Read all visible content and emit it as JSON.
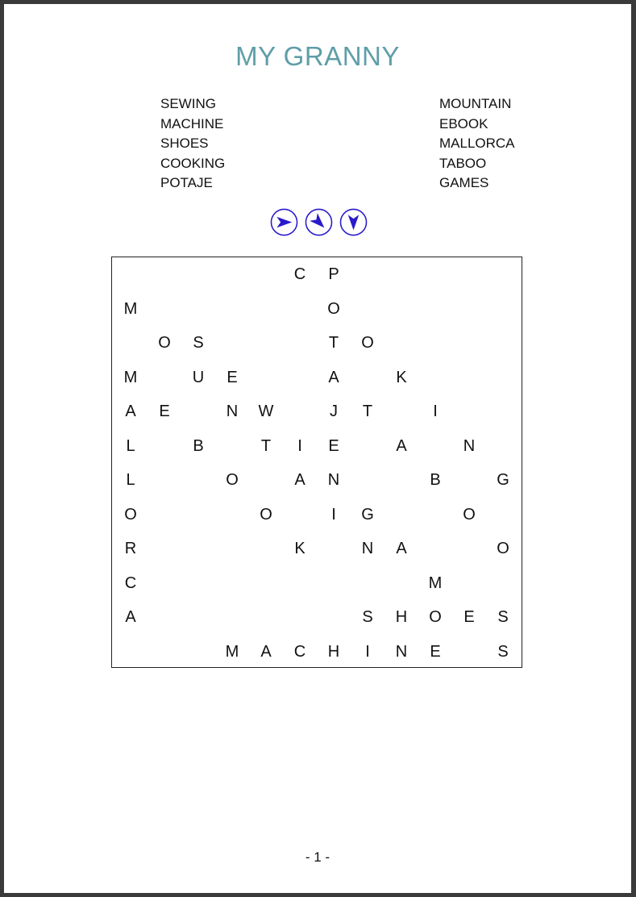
{
  "title": "MY GRANNY",
  "word_list": {
    "left": [
      "SEWING",
      "MACHINE",
      "SHOES",
      "COOKING",
      "POTAJE"
    ],
    "right": [
      "MOUNTAIN",
      "EBOOK",
      "MALLORCA",
      "TABOO",
      "GAMES"
    ]
  },
  "direction_icons": [
    "arrow-right-icon",
    "arrow-diagonal-down-right-icon",
    "arrow-down-icon"
  ],
  "accent_color": "#2a1acc",
  "title_color": "#5f9ea8",
  "grid": [
    [
      "",
      "",
      "",
      "",
      "",
      "C",
      "P",
      "",
      "",
      "",
      "",
      ""
    ],
    [
      "M",
      "",
      "",
      "",
      "",
      "",
      "O",
      "",
      "",
      "",
      "",
      ""
    ],
    [
      "",
      "O",
      "S",
      "",
      "",
      "",
      "T",
      "O",
      "",
      "",
      "",
      ""
    ],
    [
      "M",
      "",
      "U",
      "E",
      "",
      "",
      "A",
      "",
      "K",
      "",
      "",
      ""
    ],
    [
      "A",
      "E",
      "",
      "N",
      "W",
      "",
      "J",
      "T",
      "",
      "I",
      "",
      ""
    ],
    [
      "L",
      "",
      "B",
      "",
      "T",
      "I",
      "E",
      "",
      "A",
      "",
      "N",
      ""
    ],
    [
      "L",
      "",
      "",
      "O",
      "",
      "A",
      "N",
      "",
      "",
      "B",
      "",
      "G"
    ],
    [
      "O",
      "",
      "",
      "",
      "O",
      "",
      "I",
      "G",
      "",
      "",
      "O",
      ""
    ],
    [
      "R",
      "",
      "",
      "",
      "",
      "K",
      "",
      "N",
      "A",
      "",
      "",
      "O"
    ],
    [
      "C",
      "",
      "",
      "",
      "",
      "",
      "",
      "",
      "",
      "M",
      "",
      ""
    ],
    [
      "A",
      "",
      "",
      "",
      "",
      "",
      "",
      "S",
      "H",
      "O",
      "E",
      "S"
    ],
    [
      "",
      "",
      "",
      "M",
      "A",
      "C",
      "H",
      "I",
      "N",
      "E",
      "",
      "S"
    ]
  ],
  "footer": "- 1 -"
}
